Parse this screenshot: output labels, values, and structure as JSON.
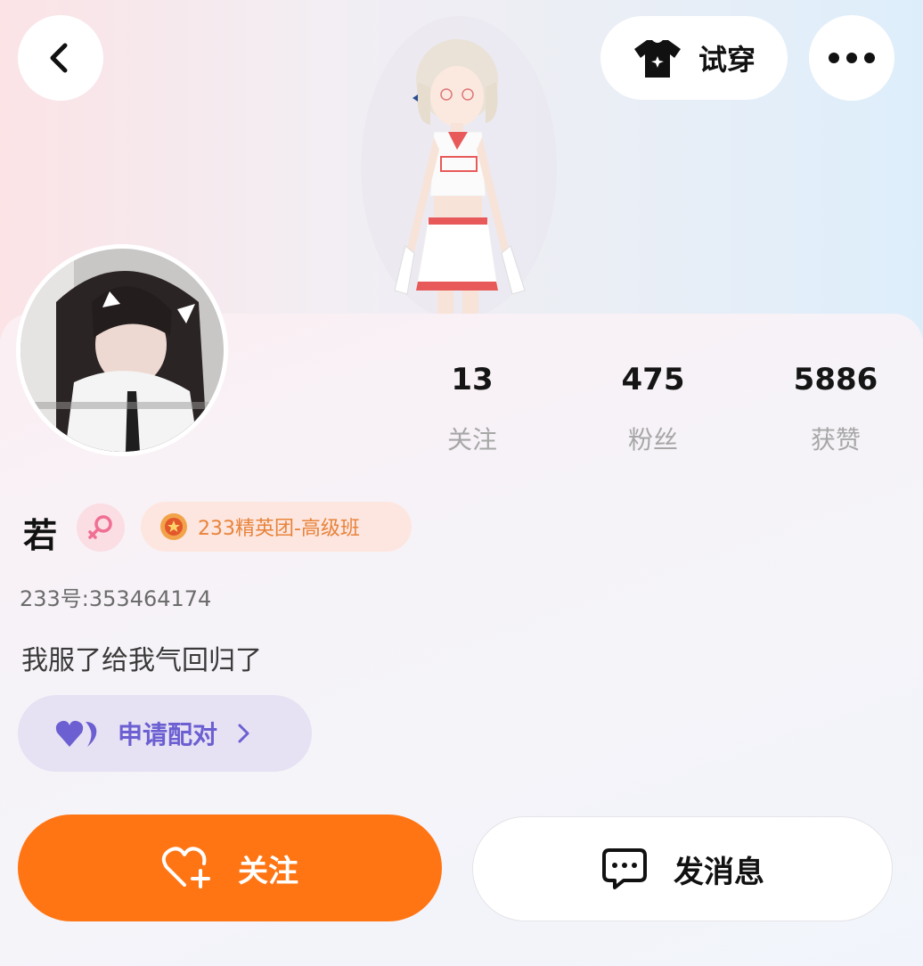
{
  "header": {
    "back_icon": "chevron-left-icon",
    "try_on_label": "试穿",
    "try_on_icon": "tshirt-icon",
    "more_icon": "more-dots-icon"
  },
  "profile": {
    "name": "若",
    "gender_icon": "female-icon",
    "badge_icon": "medal-icon",
    "badge_text": "233精英团-高级班",
    "uid": "233号:353464174",
    "bio": "我服了给我气回归了"
  },
  "stats": [
    {
      "value": "13",
      "label": "关注"
    },
    {
      "value": "475",
      "label": "粉丝"
    },
    {
      "value": "5886",
      "label": "获赞"
    }
  ],
  "pair": {
    "label": "申请配对",
    "icon": "hearts-icon",
    "chevron": "chevron-right-icon"
  },
  "actions": {
    "follow_label": "关注",
    "follow_icon": "heart-plus-icon",
    "message_label": "发消息",
    "message_icon": "chat-bubble-icon"
  },
  "colors": {
    "accent_orange": "#ff7514",
    "pair_purple": "#6b5fd2",
    "badge_orange": "#e8833b",
    "gender_pink": "#f06f92"
  }
}
